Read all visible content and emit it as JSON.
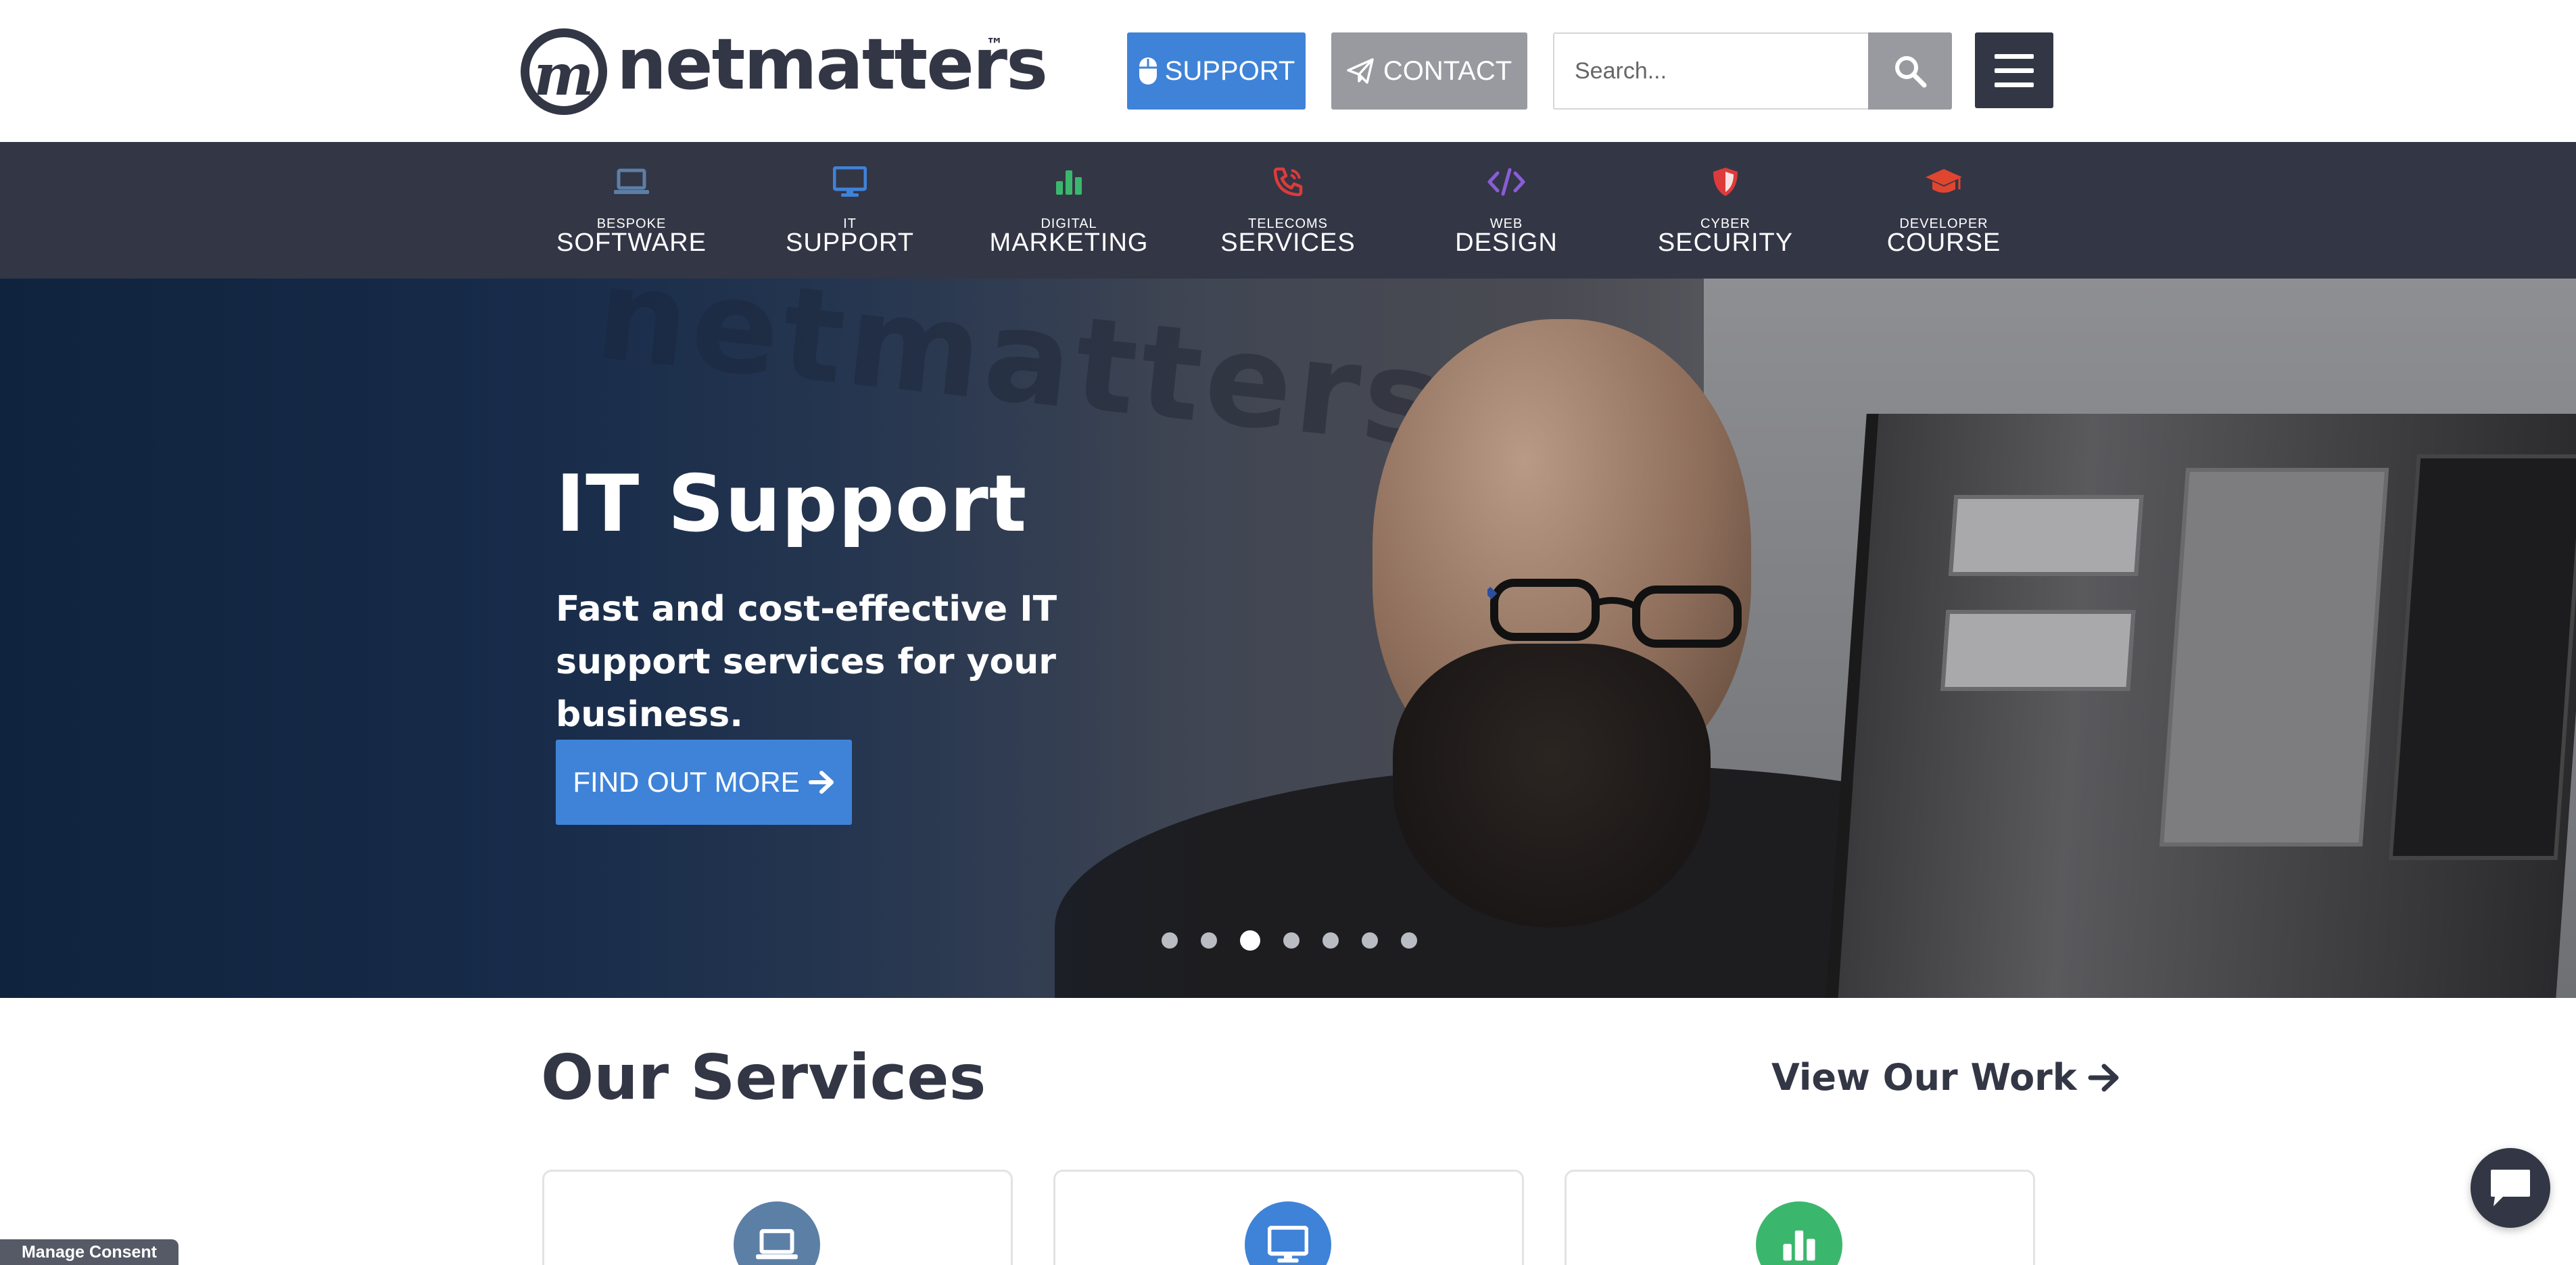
{
  "header": {
    "logo_text": "netmatters",
    "logo_mark": "m",
    "logo_tm": "™",
    "support_label": "SUPPORT",
    "contact_label": "CONTACT",
    "search_placeholder": "Search..."
  },
  "nav": {
    "items": [
      {
        "small": "BESPOKE",
        "big": "SOFTWARE",
        "icon": "laptop-icon",
        "color": "#5c7fa6"
      },
      {
        "small": "IT",
        "big": "SUPPORT",
        "icon": "monitor-icon",
        "color": "#3f83d8"
      },
      {
        "small": "DIGITAL",
        "big": "MARKETING",
        "icon": "bar-chart-icon",
        "color": "#3bb76d"
      },
      {
        "small": "TELECOMS",
        "big": "SERVICES",
        "icon": "phone-icon",
        "color": "#dd3b3b"
      },
      {
        "small": "WEB",
        "big": "DESIGN",
        "icon": "code-icon",
        "color": "#8a5dd6"
      },
      {
        "small": "CYBER",
        "big": "SECURITY",
        "icon": "shield-icon",
        "color": "#dd3b3b"
      },
      {
        "small": "DEVELOPER",
        "big": "COURSE",
        "icon": "graduation-cap-icon",
        "color": "#e0452f"
      }
    ]
  },
  "hero": {
    "background_text": "netmatters",
    "title": "IT Support",
    "subtitle": "Fast and cost-effective IT support services for your business.",
    "cta_label": "FIND OUT MORE",
    "slide_count": 7,
    "active_slide": 3
  },
  "services": {
    "title": "Our Services",
    "view_work_label": "View Our Work",
    "cards": [
      {
        "icon": "laptop-icon",
        "color": "#5c7fa6"
      },
      {
        "icon": "monitor-icon",
        "color": "#3f83d8"
      },
      {
        "icon": "bar-chart-icon",
        "color": "#3bb76d"
      }
    ]
  },
  "footer": {
    "consent_label": "Manage Consent"
  },
  "colors": {
    "dark": "#333645",
    "primary_blue": "#3f83d8",
    "grey_button": "#999aa0"
  }
}
